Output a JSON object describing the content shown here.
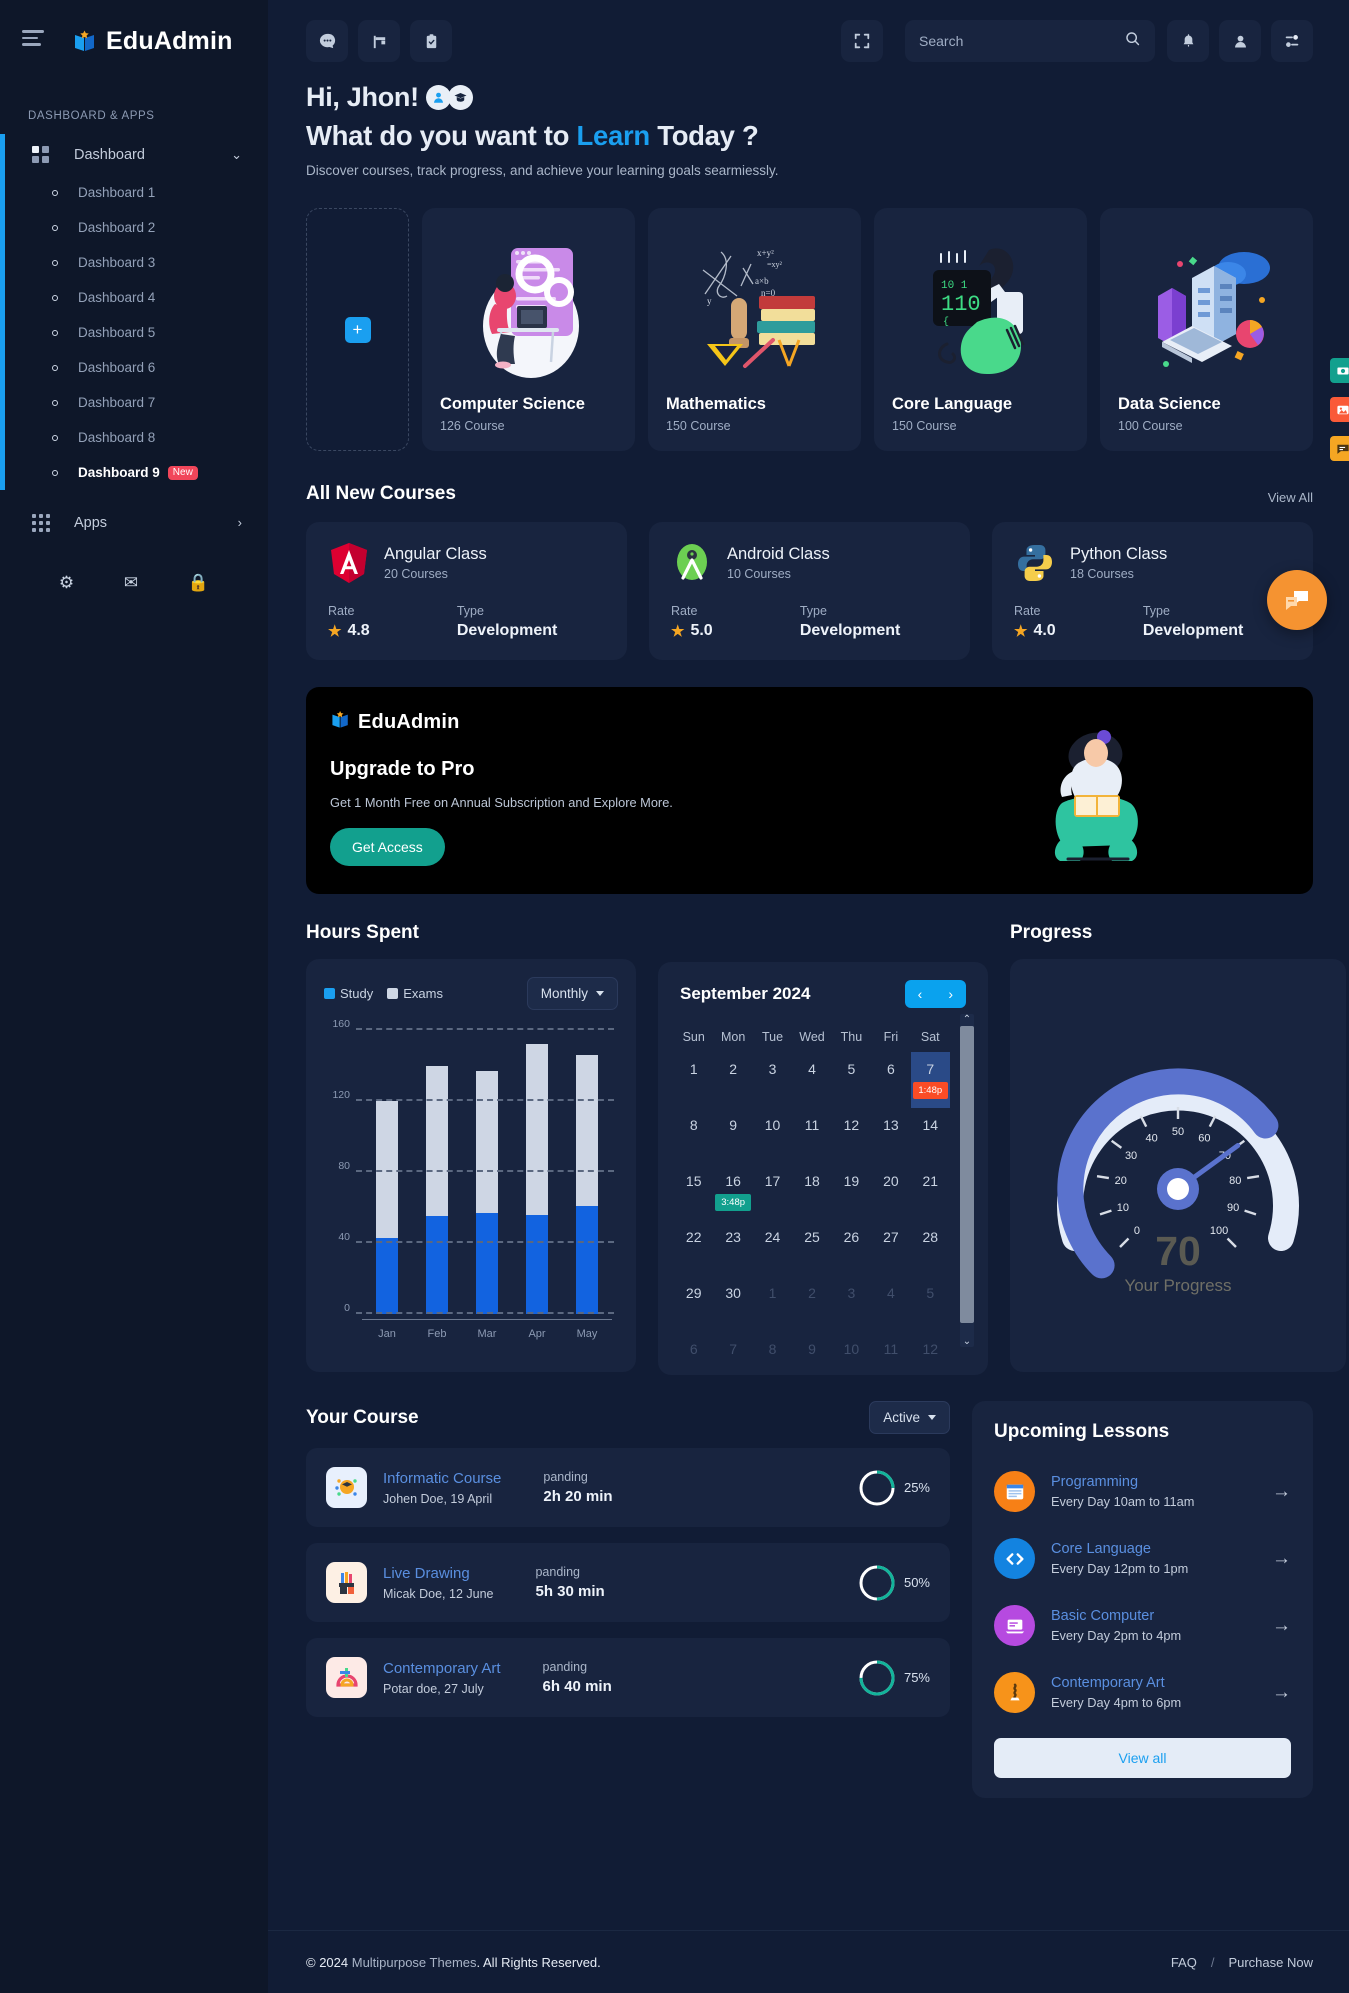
{
  "brand": {
    "name": "EduAdmin"
  },
  "sidebar": {
    "section_label": "DASHBOARD & APPS",
    "dashboard": {
      "label": "Dashboard",
      "icon": "grid-icon",
      "chevron": "chevron-down-icon"
    },
    "sub_items": [
      {
        "label": "Dashboard 1"
      },
      {
        "label": "Dashboard 2"
      },
      {
        "label": "Dashboard 3"
      },
      {
        "label": "Dashboard 4"
      },
      {
        "label": "Dashboard 5"
      },
      {
        "label": "Dashboard 6"
      },
      {
        "label": "Dashboard 7"
      },
      {
        "label": "Dashboard 8"
      },
      {
        "label": "Dashboard 9",
        "badge": "New"
      }
    ],
    "apps": {
      "label": "Apps",
      "icon": "apps-grid-icon",
      "chevron": "chevron-right-icon"
    },
    "bottom_icons": [
      "gear-icon",
      "envelope-icon",
      "lock-icon"
    ]
  },
  "topbar": {
    "menu_icon": "hamburger-icon",
    "left_icons": [
      "chat-icon",
      "flag-icon",
      "clipboard-check-icon"
    ],
    "fullscreen_icon": "fullscreen-icon",
    "search": {
      "placeholder": "Search",
      "value": "",
      "icon": "search-icon"
    },
    "right_icons": [
      "bell-icon",
      "user-icon",
      "settings-sliders-icon"
    ]
  },
  "hero": {
    "greeting": "Hi, Jhon!",
    "title_before": "What do you want to ",
    "title_highlight": "Learn",
    "title_after": " Today ?",
    "description": "Discover courses, track progress, and achieve your learning goals searmiessly."
  },
  "categories": {
    "add_label": "+",
    "items": [
      {
        "title": "Computer Science",
        "courses": "126 Course",
        "art": "computer-science-illustration"
      },
      {
        "title": "Mathematics",
        "courses": "150 Course",
        "art": "mathematics-illustration"
      },
      {
        "title": "Core Language",
        "courses": "150 Course",
        "art": "core-language-illustration"
      },
      {
        "title": "Data Science",
        "courses": "100 Course",
        "art": "data-science-illustration"
      }
    ]
  },
  "new_courses": {
    "section_title": "All New Courses",
    "view_all": "View All",
    "rate_label": "Rate",
    "type_label": "Type",
    "items": [
      {
        "name": "Angular Class",
        "count": "20 Courses",
        "rate": "4.8",
        "type": "Development",
        "logo": "angular-logo"
      },
      {
        "name": "Android Class",
        "count": "10 Courses",
        "rate": "5.0",
        "type": "Development",
        "logo": "android-logo"
      },
      {
        "name": "Python Class",
        "count": "18 Courses",
        "rate": "4.0",
        "type": "Development",
        "logo": "python-logo"
      }
    ]
  },
  "promo": {
    "brand": "EduAdmin",
    "heading": "Upgrade to Pro",
    "subtext": "Get 1 Month Free on Annual Subscription and Explore More.",
    "button": "Get Access"
  },
  "hours_spent": {
    "title": "Hours Spent",
    "dropdown": "Monthly",
    "legend": [
      {
        "label": "Study",
        "color": "#1a9ff0"
      },
      {
        "label": "Exams",
        "color": "#ced6e4"
      }
    ]
  },
  "chart_data": {
    "type": "bar",
    "title": "Hours Spent",
    "categories": [
      "Jan",
      "Feb",
      "Mar",
      "Apr",
      "May"
    ],
    "series": [
      {
        "name": "Study",
        "color": "#1263e0",
        "values": [
          43,
          55,
          57,
          56,
          61
        ]
      },
      {
        "name": "Exams",
        "color": "#ced6e4",
        "values": [
          77,
          85,
          80,
          96,
          85
        ]
      }
    ],
    "stacked": true,
    "ylabel": "",
    "xlabel": "",
    "ylim": [
      0,
      160
    ],
    "yticks": [
      0,
      40,
      80,
      120,
      160
    ],
    "grid": true,
    "legend_position": "top-left"
  },
  "calendar": {
    "month": "September 2024",
    "prev_icon": "chevron-left-icon",
    "next_icon": "chevron-right-icon",
    "dow": [
      "Sun",
      "Mon",
      "Tue",
      "Wed",
      "Thu",
      "Fri",
      "Sat"
    ],
    "weeks": [
      [
        {
          "d": "1"
        },
        {
          "d": "2"
        },
        {
          "d": "3"
        },
        {
          "d": "4"
        },
        {
          "d": "5"
        },
        {
          "d": "6"
        },
        {
          "d": "7",
          "selected": true,
          "event": "1:48p",
          "event_color": "#fa4c26"
        }
      ],
      [
        {
          "d": "8"
        },
        {
          "d": "9"
        },
        {
          "d": "10"
        },
        {
          "d": "11"
        },
        {
          "d": "12"
        },
        {
          "d": "13"
        },
        {
          "d": "14"
        }
      ],
      [
        {
          "d": "15"
        },
        {
          "d": "16",
          "event": "3:48p",
          "event_color": "#12a08e"
        },
        {
          "d": "17"
        },
        {
          "d": "18"
        },
        {
          "d": "19"
        },
        {
          "d": "20"
        },
        {
          "d": "21"
        }
      ],
      [
        {
          "d": "22"
        },
        {
          "d": "23"
        },
        {
          "d": "24"
        },
        {
          "d": "25"
        },
        {
          "d": "26"
        },
        {
          "d": "27"
        },
        {
          "d": "28"
        }
      ],
      [
        {
          "d": "29"
        },
        {
          "d": "30"
        },
        {
          "d": "1",
          "muted": true
        },
        {
          "d": "2",
          "muted": true
        },
        {
          "d": "3",
          "muted": true
        },
        {
          "d": "4",
          "muted": true
        },
        {
          "d": "5",
          "muted": true
        }
      ],
      [
        {
          "d": "6",
          "muted": true
        },
        {
          "d": "7",
          "muted": true
        },
        {
          "d": "8",
          "muted": true
        },
        {
          "d": "9",
          "muted": true
        },
        {
          "d": "10",
          "muted": true
        },
        {
          "d": "11",
          "muted": true
        },
        {
          "d": "12",
          "muted": true
        }
      ]
    ]
  },
  "progress": {
    "title": "Progress",
    "value": "70",
    "caption": "Your Progress",
    "ticks": [
      "0",
      "10",
      "20",
      "30",
      "40",
      "50",
      "60",
      "70",
      "80",
      "90",
      "100"
    ],
    "arc_color": "#5a72cd",
    "track_color": "#e4ecf9"
  },
  "your_course": {
    "title": "Your Course",
    "filter": "Active",
    "items": [
      {
        "name": "Informatic Course",
        "by": "Johen Doe, 19 April",
        "status": "panding",
        "time": "2h 20 min",
        "percent": "25%",
        "pct": 25,
        "icon": "informatic-icon"
      },
      {
        "name": "Live Drawing",
        "by": "Micak Doe, 12 June",
        "status": "panding",
        "time": "5h 30 min",
        "percent": "50%",
        "pct": 50,
        "icon": "drawing-icon"
      },
      {
        "name": "Contemporary Art",
        "by": "Potar doe, 27 July",
        "status": "panding",
        "time": "6h 40 min",
        "percent": "75%",
        "pct": 75,
        "icon": "art-icon"
      }
    ]
  },
  "upcoming": {
    "title": "Upcoming Lessons",
    "view_all": "View all",
    "items": [
      {
        "name": "Programming",
        "when": "Every Day 10am to 11am",
        "icon": "window-code-icon",
        "color": "#f78016"
      },
      {
        "name": "Core Language",
        "when": "Every Day 12pm to 1pm",
        "icon": "code-brackets-icon",
        "color": "#1383e0"
      },
      {
        "name": "Basic Computer",
        "when": "Every Day 2pm to 4pm",
        "icon": "laptop-icon",
        "color": "#b64ae0"
      },
      {
        "name": "Contemporary Art",
        "when": "Every Day 4pm to 6pm",
        "icon": "sculpture-icon",
        "color": "#f7931a"
      }
    ]
  },
  "floats": {
    "squares": [
      {
        "icon": "camera-icon",
        "color": "#12a08e"
      },
      {
        "icon": "image-icon",
        "color": "#fa5a38"
      },
      {
        "icon": "comment-icon",
        "color": "#f5a623"
      }
    ],
    "fab": {
      "icon": "chat-bubble-icon",
      "color": "#f59331"
    }
  },
  "footer": {
    "copyright_pre": "© 2024 ",
    "company": "Multipurpose Themes",
    "copyright_post": ". All Rights Reserved.",
    "links": [
      "FAQ",
      "Purchase Now"
    ],
    "separator": "/"
  }
}
